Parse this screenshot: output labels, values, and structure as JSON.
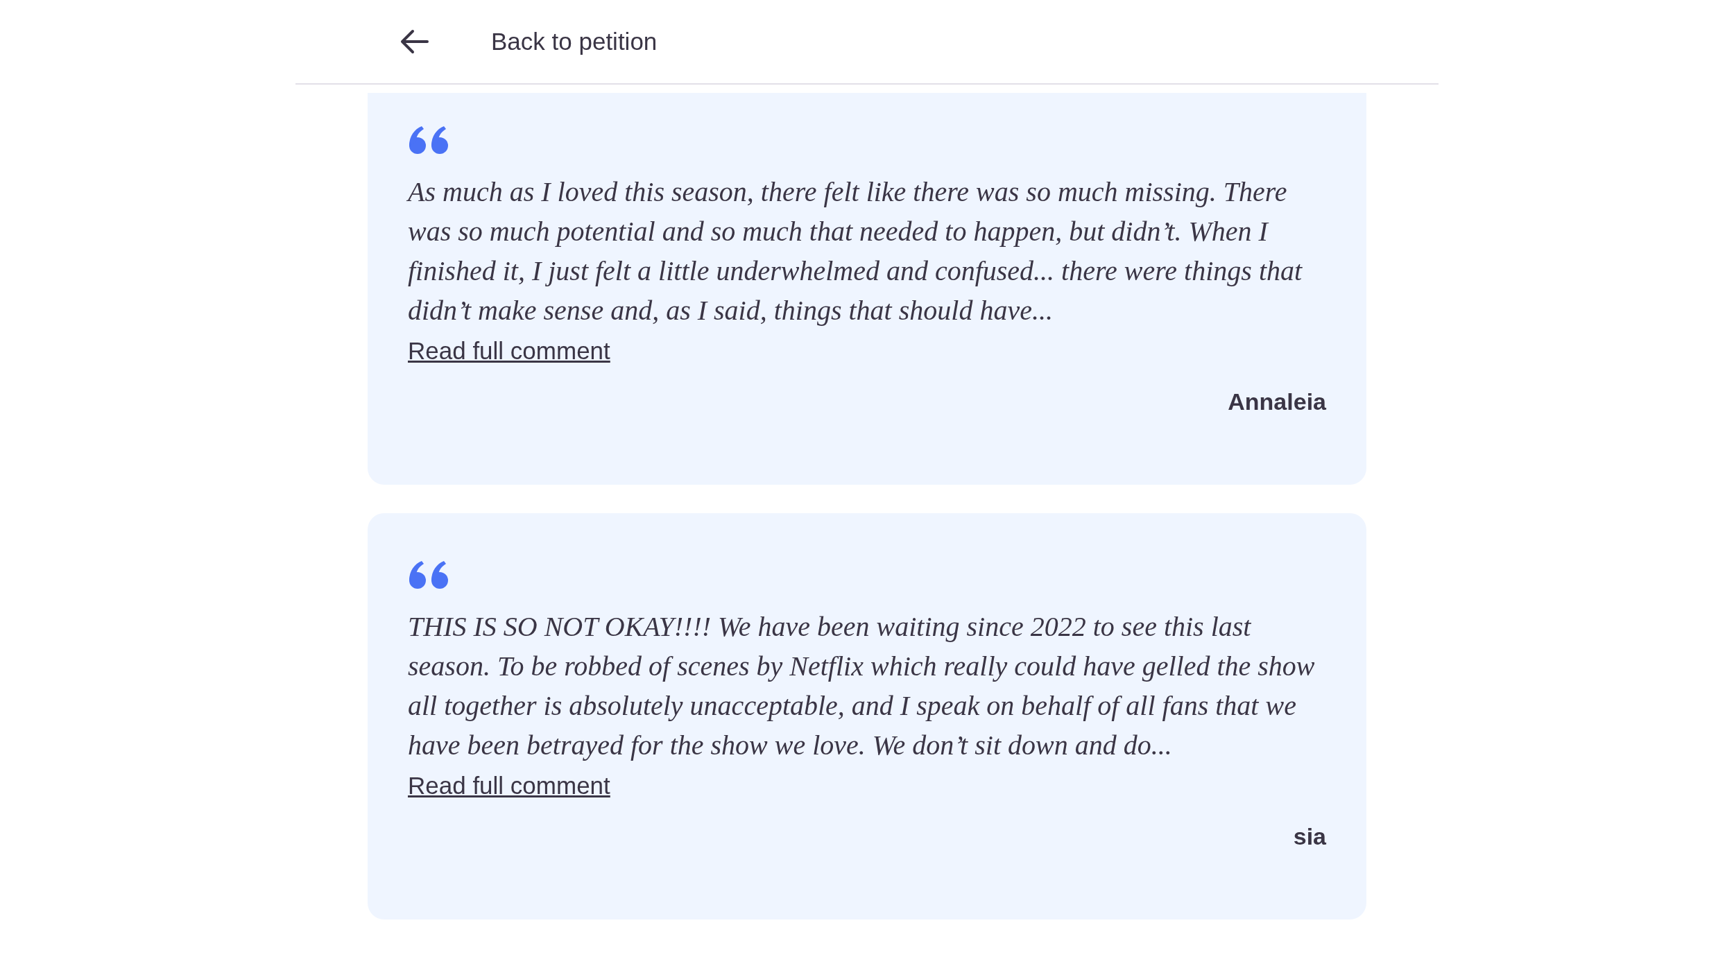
{
  "header": {
    "back_label": "Back to petition"
  },
  "comments": [
    {
      "text": "As much as I loved this season, there felt like there was so much missing. There was so much potential and so much that needed to happen, but didn’t. When I finished it, I just felt a little underwhelmed and confused... there were things that didn’t make sense and, as I said, things that should have...",
      "link": "Read full comment",
      "author": "Annaleia"
    },
    {
      "text": "THIS IS SO NOT OKAY!!!! We have been waiting since 2022 to see this last season. To be robbed of scenes by Netflix which really could have gelled the show all together is absolutely unacceptable, and I speak on behalf of all fans that we have been betrayed for the show we love. We don’t sit down and do...",
      "link": "Read full comment",
      "author": "sia"
    }
  ]
}
